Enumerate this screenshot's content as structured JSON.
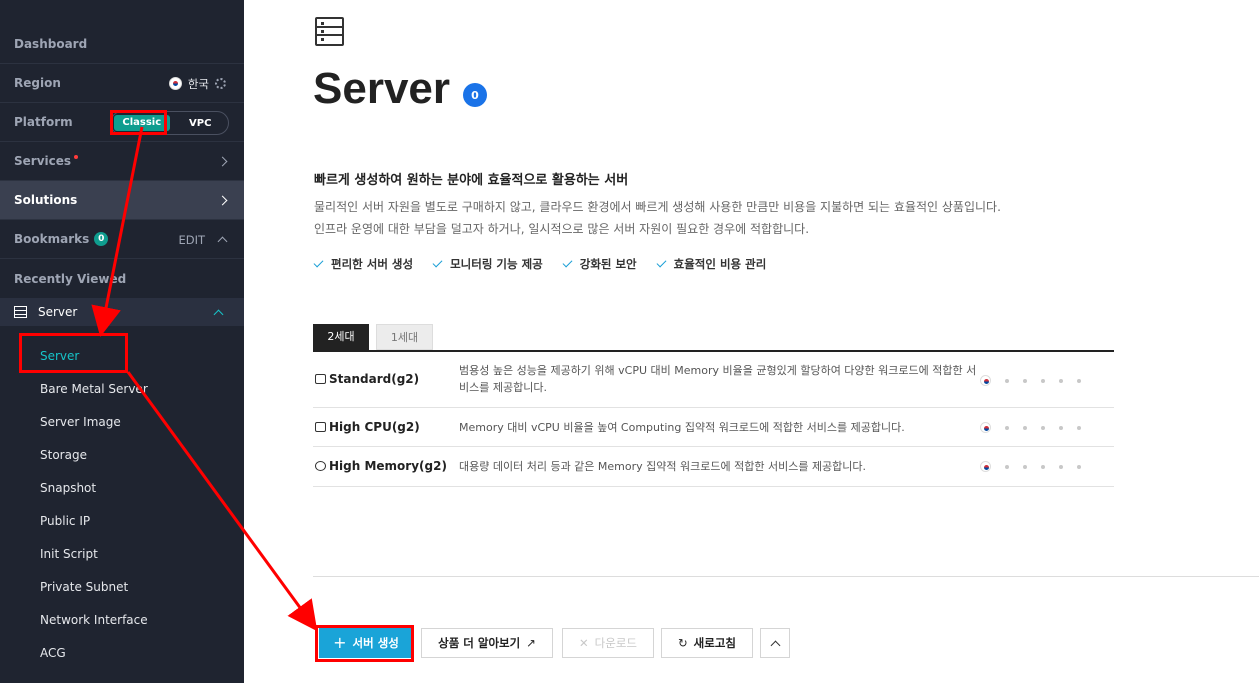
{
  "sidebar": {
    "dashboard": "Dashboard",
    "region_label": "Region",
    "region_value": "한국",
    "platform_label": "Platform",
    "platform_options": [
      "Classic",
      "VPC"
    ],
    "services": "Services",
    "solutions": "Solutions",
    "bookmarks": "Bookmarks",
    "bookmarks_count": "0",
    "bookmarks_edit": "EDIT",
    "recently_viewed": "Recently Viewed",
    "section": "Server",
    "items": [
      "Server",
      "Bare Metal Server",
      "Server Image",
      "Storage",
      "Snapshot",
      "Public IP",
      "Init Script",
      "Private Subnet",
      "Network Interface",
      "ACG"
    ]
  },
  "main": {
    "title": "Server",
    "title_count": "0",
    "headline": "빠르게 생성하여 원하는 분야에 효율적으로 활용하는 서버",
    "desc1": "물리적인 서버 자원을 별도로 구매하지 않고, 클라우드 환경에서 빠르게 생성해 사용한 만큼만 비용을 지불하면 되는 효율적인 상품입니다.",
    "desc2": "인프라 운영에 대한 부담을 덜고자 하거나, 일시적으로 많은 서버 자원이 필요한 경우에 적합합니다.",
    "features": [
      "편리한 서버 생성",
      "모니터링 기능 제공",
      "강화된 보안",
      "효율적인 비용 관리"
    ],
    "tabs": [
      "2세대",
      "1세대"
    ],
    "rows": [
      {
        "name": "Standard(g2)",
        "desc": "범용성 높은 성능을 제공하기 위해 vCPU 대비 Memory 비율을 균형있게 할당하여 다양한 워크로드에 적합한 서비스를 제공합니다."
      },
      {
        "name": "High CPU(g2)",
        "desc": "Memory 대비 vCPU 비율을 높여 Computing 집약적 워크로드에 적합한 서비스를 제공합니다."
      },
      {
        "name": "High Memory(g2)",
        "desc": "대용량 데이터 처리 등과 같은 Memory 집약적 워크로드에 적합한 서비스를 제공합니다."
      }
    ],
    "buttons": {
      "create": "서버 생성",
      "learn_more": "상품 더 알아보기",
      "download": "다운로드",
      "refresh": "새로고침"
    }
  },
  "colors": {
    "sidebar_bg": "#1f2430",
    "accent_teal": "#16c4c9",
    "primary_button": "#1aa4d8",
    "annotation": "#ff0000"
  }
}
